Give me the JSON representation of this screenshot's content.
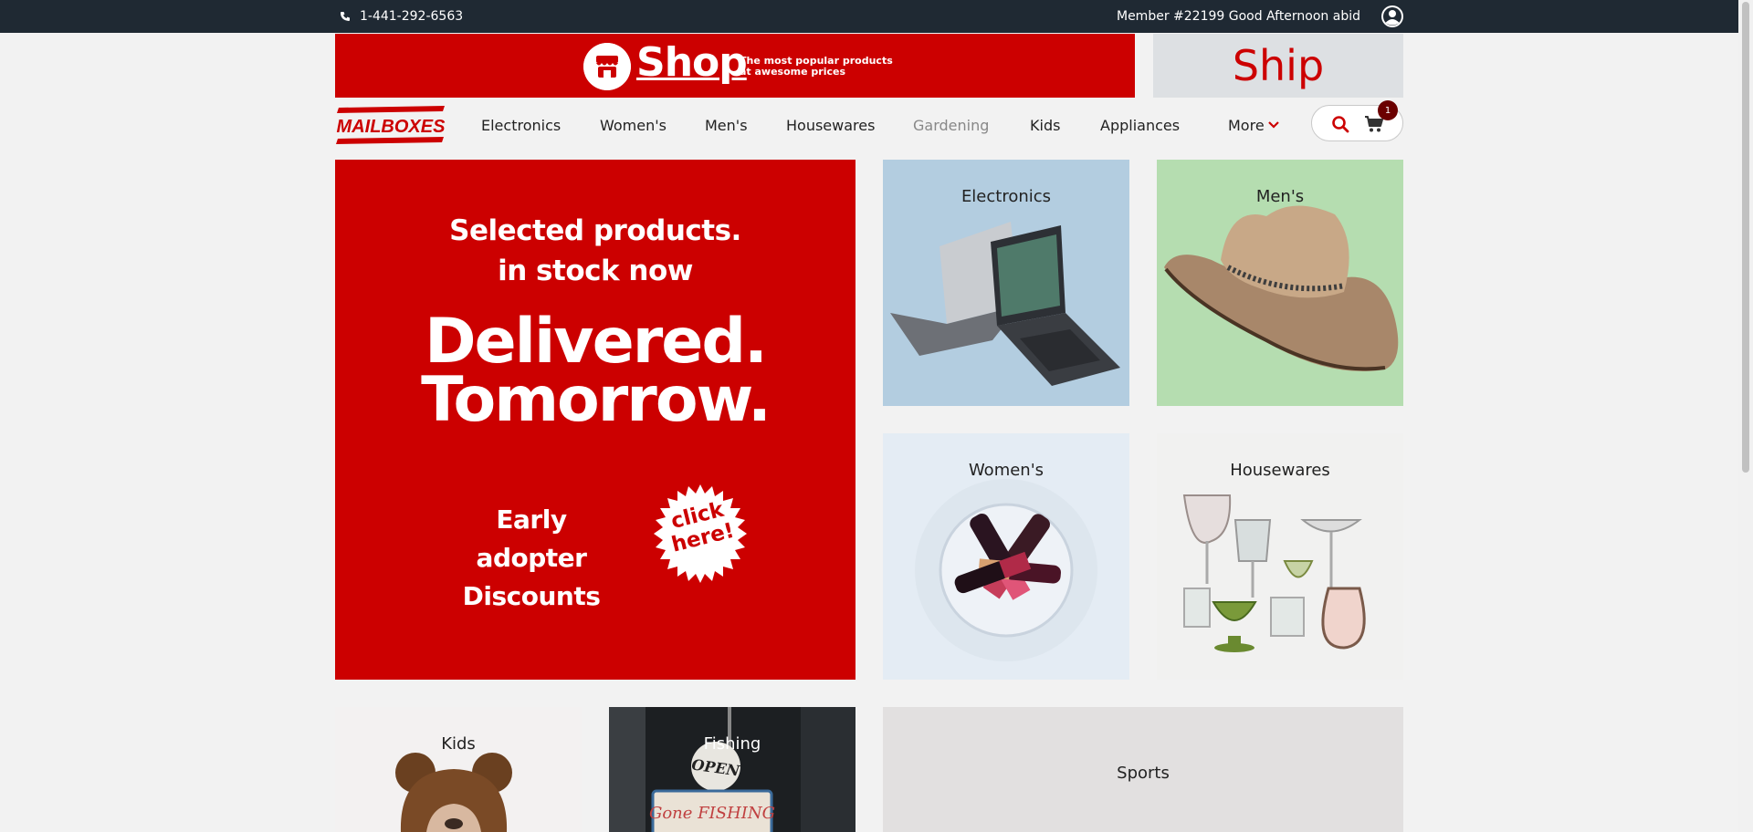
{
  "topbar": {
    "phone": "1-441-292-6563",
    "greeting": "Member #22199 Good Afternoon abid",
    "phone_icon": "phone-icon",
    "user_icon": "user-circle-icon"
  },
  "banner": {
    "shop_label": "Shop",
    "shop_tagline": "The most popular products at awesome prices",
    "ship_label": "Ship",
    "store_icon": "store-icon"
  },
  "logo": {
    "text": "MAILBOXES"
  },
  "nav": {
    "items": [
      {
        "label": "Electronics"
      },
      {
        "label": "Women's"
      },
      {
        "label": "Men's"
      },
      {
        "label": "Housewares"
      },
      {
        "label": "Gardening"
      },
      {
        "label": "Kids"
      },
      {
        "label": "Appliances"
      }
    ],
    "more_label": "More",
    "cart_count": "1"
  },
  "hero": {
    "line1": "Selected products.",
    "line2": "in stock now",
    "big1": "Delivered.",
    "big2": "Tomorrow.",
    "early_line1": "Early adopter",
    "early_line2": "Discounts",
    "click_line1": "click",
    "click_line2": "here!"
  },
  "tiles": {
    "electronics": "Electronics",
    "mens": "Men's",
    "womens": "Women's",
    "housewares": "Housewares",
    "kids": "Kids",
    "fishing": "Fishing",
    "sports": "Sports",
    "fishing_sign_open": "OPEN",
    "fishing_sign_gone": "Gone FISHING"
  },
  "colors": {
    "brand_red": "#cc0000",
    "topbar": "#1f2933",
    "electronics_bg": "#b3cde0",
    "mens_bg": "#b5ddb0"
  }
}
